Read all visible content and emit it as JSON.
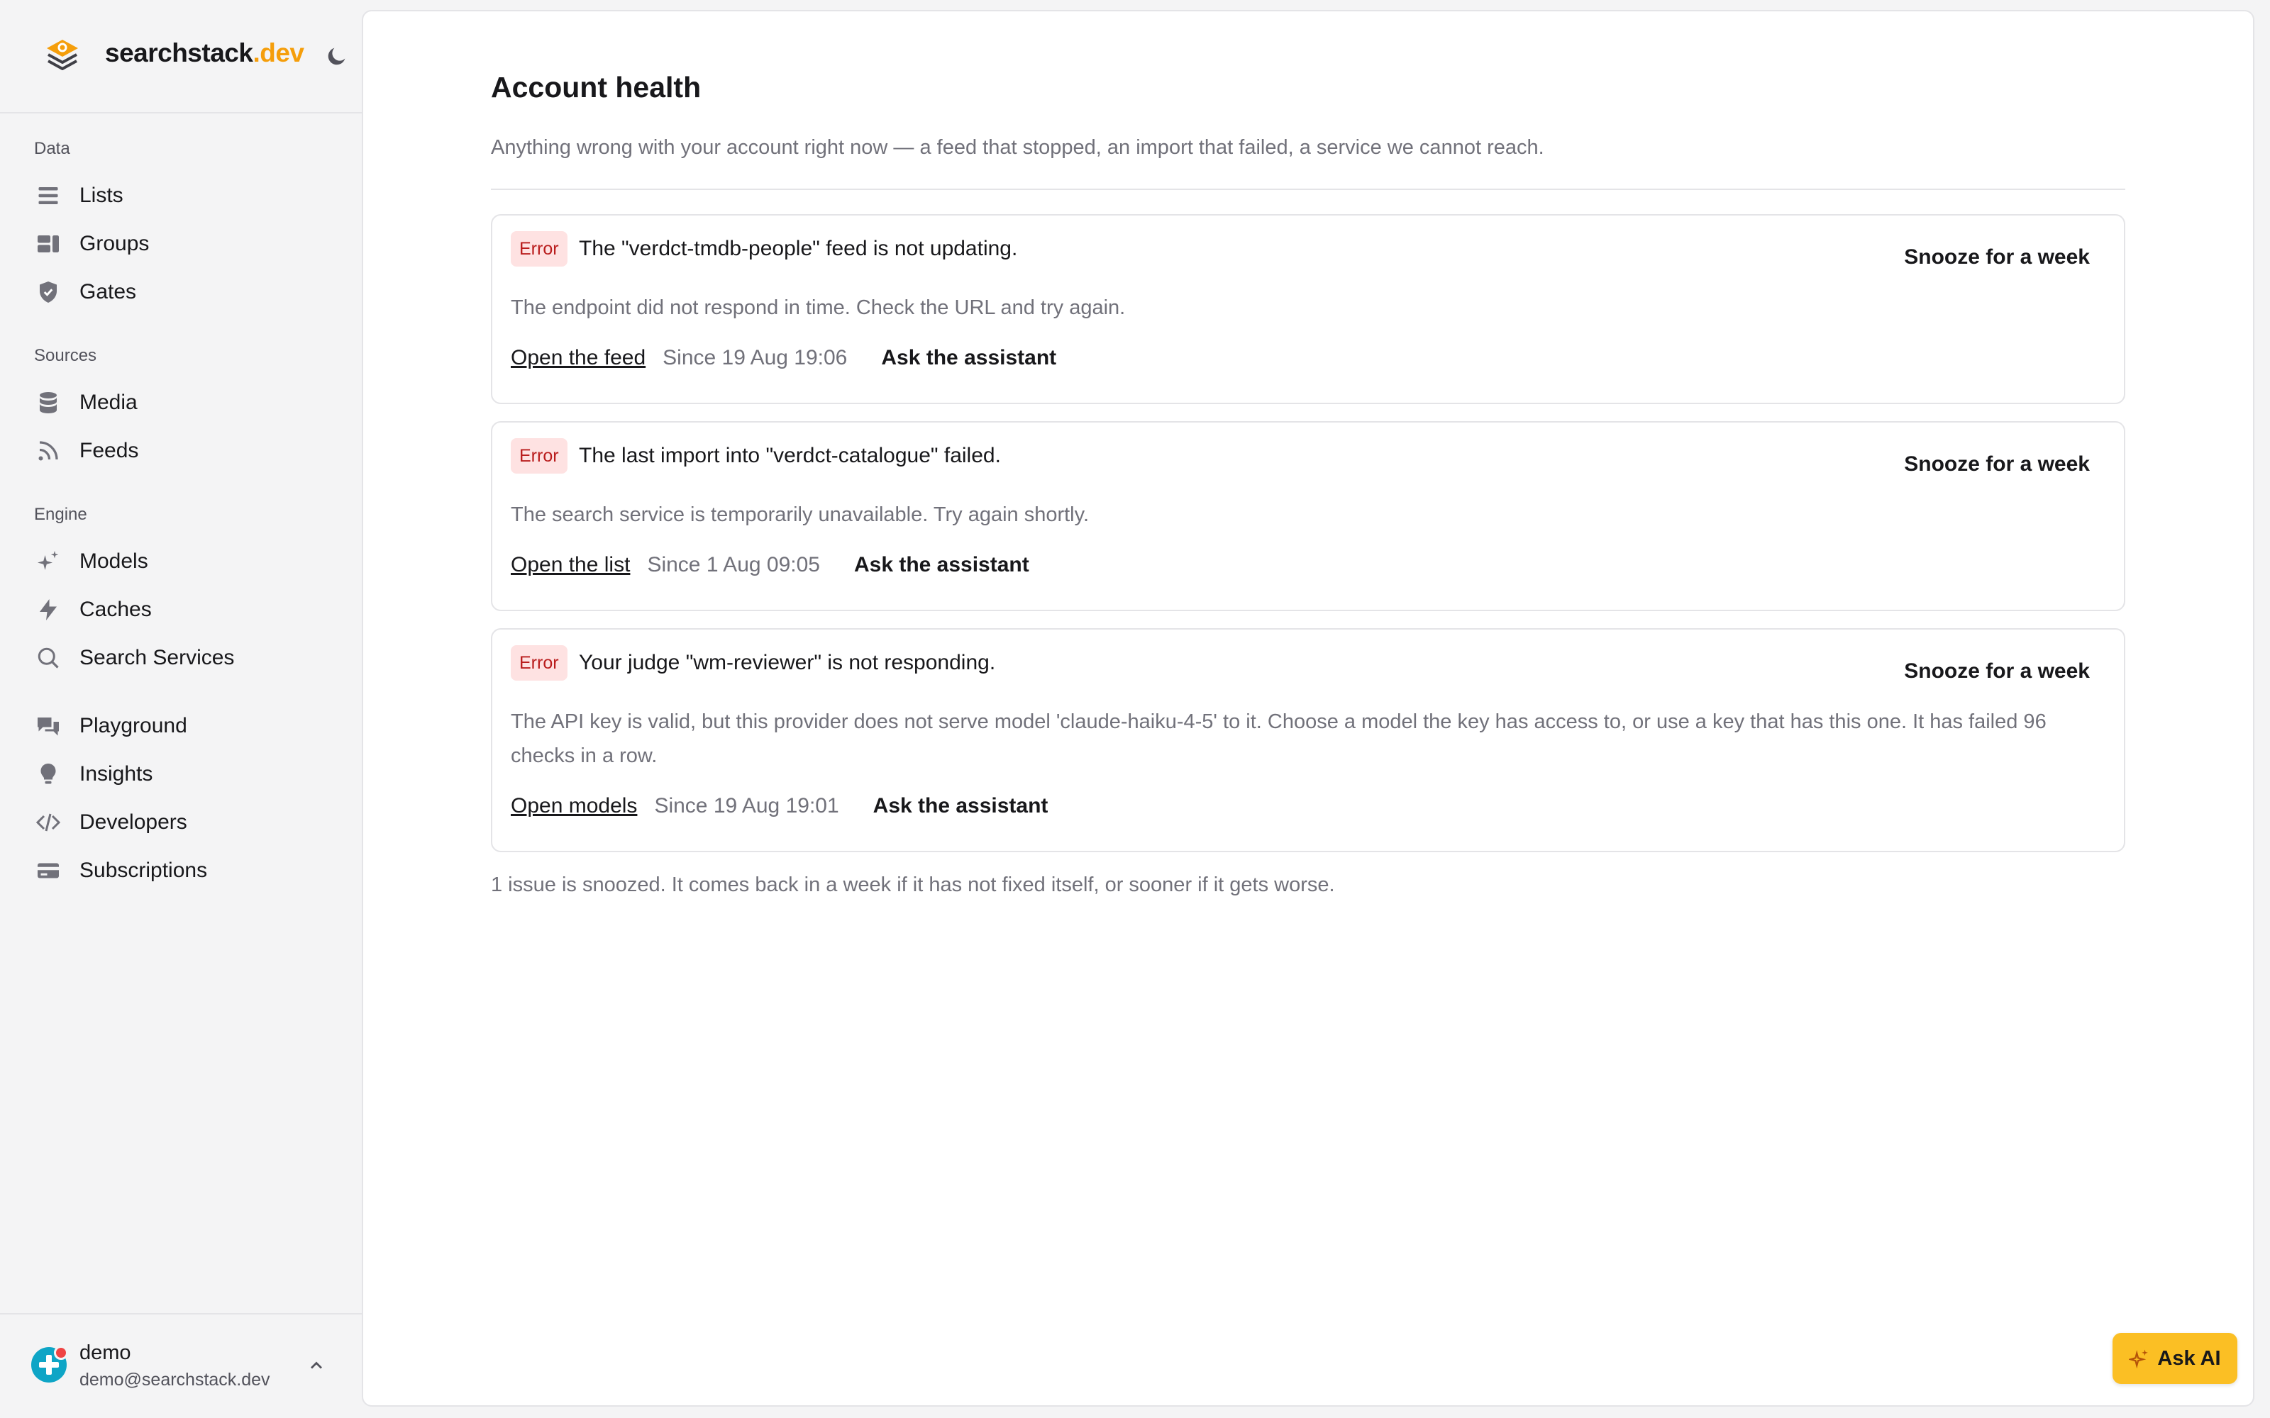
{
  "app": {
    "brand_name": "searchstack",
    "brand_tld": ".dev",
    "brand_color": "#f59e0b"
  },
  "sidebar": {
    "sections": [
      {
        "title": "Data",
        "items": [
          {
            "label": "Lists",
            "icon": "list-icon"
          },
          {
            "label": "Groups",
            "icon": "groups-icon"
          },
          {
            "label": "Gates",
            "icon": "shield-icon"
          }
        ]
      },
      {
        "title": "Sources",
        "items": [
          {
            "label": "Media",
            "icon": "database-icon"
          },
          {
            "label": "Feeds",
            "icon": "rss-icon"
          }
        ]
      },
      {
        "title": "Engine",
        "items": [
          {
            "label": "Models",
            "icon": "sparkles-icon"
          },
          {
            "label": "Caches",
            "icon": "bolt-icon"
          },
          {
            "label": "Search Services",
            "icon": "search-icon"
          }
        ]
      },
      {
        "title": "",
        "items": [
          {
            "label": "Playground",
            "icon": "chat-icon"
          },
          {
            "label": "Insights",
            "icon": "lightbulb-icon"
          },
          {
            "label": "Developers",
            "icon": "code-icon"
          },
          {
            "label": "Subscriptions",
            "icon": "credit-card-icon"
          }
        ]
      }
    ],
    "user": {
      "name": "demo",
      "email": "demo@searchstack.dev"
    }
  },
  "page": {
    "title": "Account health",
    "subtitle": "Anything wrong with your account right now — a feed that stopped, an import that failed, a service we cannot reach.",
    "issues": [
      {
        "severity": "Error",
        "title": "The \"verdct-tmdb-people\" feed is not updating.",
        "description": "The endpoint did not respond in time. Check the URL and try again.",
        "link_label": "Open the feed",
        "since": "Since 19 Aug 19:06",
        "ask_label": "Ask the assistant",
        "snooze_label": "Snooze for a week"
      },
      {
        "severity": "Error",
        "title": "The last import into \"verdct-catalogue\" failed.",
        "description": "The search service is temporarily unavailable. Try again shortly.",
        "link_label": "Open the list",
        "since": "Since 1 Aug 09:05",
        "ask_label": "Ask the assistant",
        "snooze_label": "Snooze for a week"
      },
      {
        "severity": "Error",
        "title": "Your judge \"wm-reviewer\" is not responding.",
        "description": "The API key is valid, but this provider does not serve model 'claude-haiku-4-5' to it. Choose a model the key has access to, or use a key that has this one. It has failed 96 checks in a row.",
        "link_label": "Open models",
        "since": "Since 19 Aug 19:01",
        "ask_label": "Ask the assistant",
        "snooze_label": "Snooze for a week"
      }
    ],
    "footnote": "1 issue is snoozed. It comes back in a week if it has not fixed itself, or sooner if it gets worse."
  },
  "ask_ai": {
    "label": "Ask AI",
    "color": "#fbbf24"
  }
}
